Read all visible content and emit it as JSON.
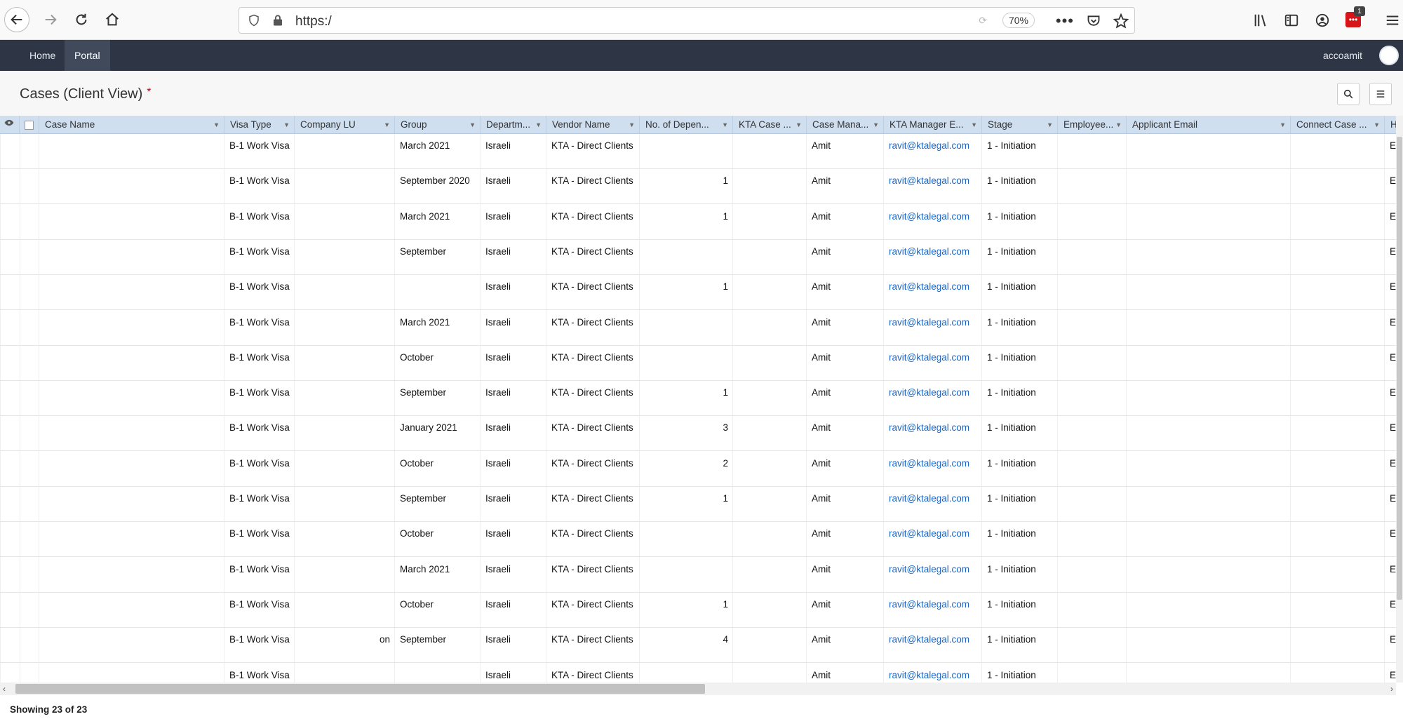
{
  "browser": {
    "url": "https:/",
    "zoom": "70%",
    "badge": "1"
  },
  "nav": {
    "items": [
      {
        "label": "Home"
      },
      {
        "label": "Portal"
      }
    ],
    "user": "accoamit"
  },
  "page": {
    "title": "Cases (Client View)",
    "modified_marker": "*"
  },
  "grid": {
    "columns": [
      "Case Name",
      "Visa Type",
      "Company LU",
      "Group",
      "Departm...",
      "Vendor Name",
      "No. of Depen...",
      "KTA Case ...",
      "Case Mana...",
      "KTA Manager E...",
      "Stage",
      "Employee...",
      "Applicant Email",
      "Connect Case ...",
      "Ho"
    ],
    "rows": [
      {
        "visa": "B-1 Work Visa",
        "company": "",
        "group": "March 2021",
        "dept": "Israeli",
        "vendor": "KTA - Direct Clients",
        "deps": "",
        "manager": "Amit",
        "email": "ravit@ktalegal.com",
        "stage": "1 - Initiation",
        "ho": "Er"
      },
      {
        "visa": "B-1 Work Visa",
        "company": "",
        "group": "September 2020",
        "dept": "Israeli",
        "vendor": "KTA - Direct Clients",
        "deps": "1",
        "manager": "Amit",
        "email": "ravit@ktalegal.com",
        "stage": "1 - Initiation",
        "ho": "Er"
      },
      {
        "visa": "B-1 Work Visa",
        "company": "",
        "group": "March 2021",
        "dept": "Israeli",
        "vendor": "KTA - Direct Clients",
        "deps": "1",
        "manager": "Amit",
        "email": "ravit@ktalegal.com",
        "stage": "1 - Initiation",
        "ho": "Er"
      },
      {
        "visa": "B-1 Work Visa",
        "company": "",
        "group": "September",
        "dept": "Israeli",
        "vendor": "KTA - Direct Clients",
        "deps": "",
        "manager": "Amit",
        "email": "ravit@ktalegal.com",
        "stage": "1 - Initiation",
        "ho": "Er"
      },
      {
        "visa": "B-1 Work Visa",
        "company": "",
        "group": "",
        "dept": "Israeli",
        "vendor": "KTA - Direct Clients",
        "deps": "1",
        "manager": "Amit",
        "email": "ravit@ktalegal.com",
        "stage": "1 - Initiation",
        "ho": "Er"
      },
      {
        "visa": "B-1 Work Visa",
        "company": "",
        "group": "March 2021",
        "dept": "Israeli",
        "vendor": "KTA - Direct Clients",
        "deps": "",
        "manager": "Amit",
        "email": "ravit@ktalegal.com",
        "stage": "1 - Initiation",
        "ho": "Er"
      },
      {
        "visa": "B-1 Work Visa",
        "company": "",
        "group": "October",
        "dept": "Israeli",
        "vendor": "KTA - Direct Clients",
        "deps": "",
        "manager": "Amit",
        "email": "ravit@ktalegal.com",
        "stage": "1 - Initiation",
        "ho": "Er"
      },
      {
        "visa": "B-1 Work Visa",
        "company": "",
        "group": "September",
        "dept": "Israeli",
        "vendor": "KTA - Direct Clients",
        "deps": "1",
        "manager": "Amit",
        "email": "ravit@ktalegal.com",
        "stage": "1 - Initiation",
        "ho": "Er"
      },
      {
        "visa": "B-1 Work Visa",
        "company": "",
        "group": "January 2021",
        "dept": "Israeli",
        "vendor": "KTA - Direct Clients",
        "deps": "3",
        "manager": "Amit",
        "email": "ravit@ktalegal.com",
        "stage": "1 - Initiation",
        "ho": "Er"
      },
      {
        "visa": "B-1 Work Visa",
        "company": "",
        "group": "October",
        "dept": "Israeli",
        "vendor": "KTA - Direct Clients",
        "deps": "2",
        "manager": "Amit",
        "email": "ravit@ktalegal.com",
        "stage": "1 - Initiation",
        "ho": "Er"
      },
      {
        "visa": "B-1 Work Visa",
        "company": "",
        "group": "September",
        "dept": "Israeli",
        "vendor": "KTA - Direct Clients",
        "deps": "1",
        "manager": "Amit",
        "email": "ravit@ktalegal.com",
        "stage": "1 - Initiation",
        "ho": "Er"
      },
      {
        "visa": "B-1 Work Visa",
        "company": "",
        "group": "October",
        "dept": "Israeli",
        "vendor": "KTA - Direct Clients",
        "deps": "",
        "manager": "Amit",
        "email": "ravit@ktalegal.com",
        "stage": "1 - Initiation",
        "ho": "Er"
      },
      {
        "visa": "B-1 Work Visa",
        "company": "",
        "group": "March 2021",
        "dept": "Israeli",
        "vendor": "KTA - Direct Clients",
        "deps": "",
        "manager": "Amit",
        "email": "ravit@ktalegal.com",
        "stage": "1 - Initiation",
        "ho": "Er"
      },
      {
        "visa": "B-1 Work Visa",
        "company": "",
        "group": "October",
        "dept": "Israeli",
        "vendor": "KTA - Direct Clients",
        "deps": "1",
        "manager": "Amit",
        "email": "ravit@ktalegal.com",
        "stage": "1 - Initiation",
        "ho": "Er"
      },
      {
        "visa": "B-1 Work Visa",
        "company": "on",
        "group": "September",
        "dept": "Israeli",
        "vendor": "KTA - Direct Clients",
        "deps": "4",
        "manager": "Amit",
        "email": "ravit@ktalegal.com",
        "stage": "1 - Initiation",
        "ho": "Er"
      },
      {
        "visa": "B-1 Work Visa",
        "company": "",
        "group": "",
        "dept": "Israeli",
        "vendor": "KTA - Direct Clients",
        "deps": "",
        "manager": "Amit",
        "email": "ravit@ktalegal.com",
        "stage": "1 - Initiation",
        "ho": "Er"
      }
    ]
  },
  "footer": {
    "status": "Showing 23 of 23"
  }
}
